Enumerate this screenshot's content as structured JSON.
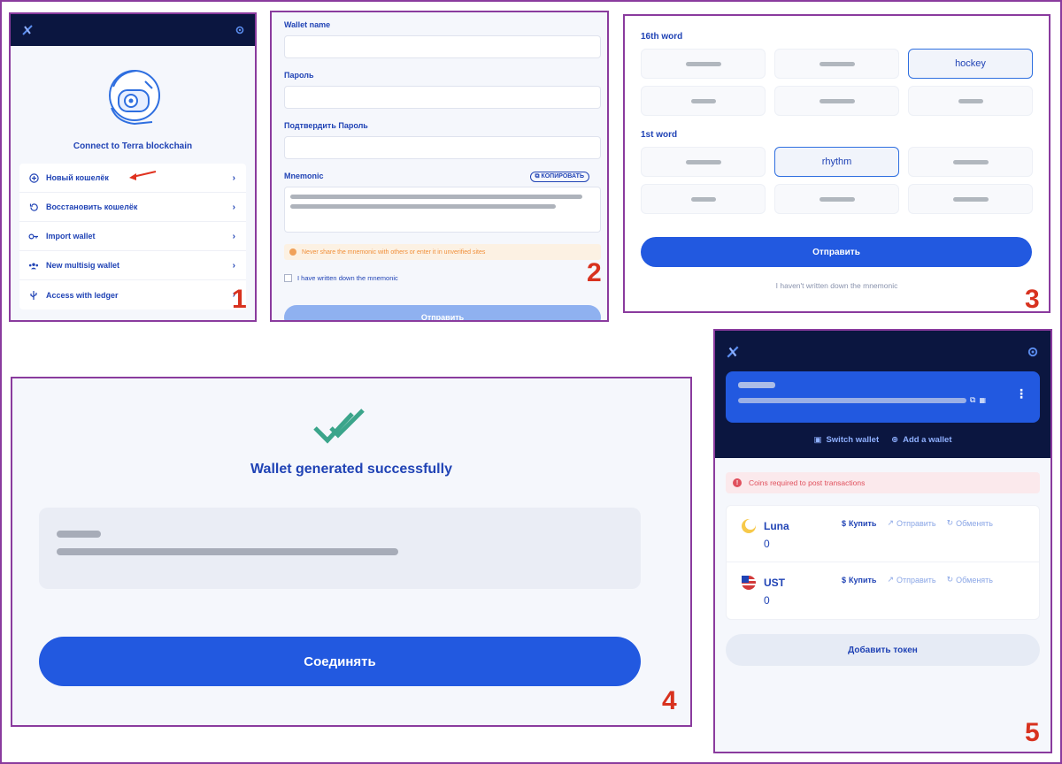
{
  "panel1": {
    "heading": "Connect to Terra blockchain",
    "menu": [
      {
        "label": "Новый кошелёк",
        "icon": "plus-circle-icon"
      },
      {
        "label": "Восстановить кошелёк",
        "icon": "restore-icon"
      },
      {
        "label": "Import wallet",
        "icon": "key-icon"
      },
      {
        "label": "New multisig wallet",
        "icon": "users-icon"
      },
      {
        "label": "Access with ledger",
        "icon": "usb-icon"
      }
    ],
    "step_number": "1"
  },
  "panel2": {
    "wallet_name_label": "Wallet name",
    "password_label": "Пароль",
    "confirm_password_label": "Подтвердить Пароль",
    "mnemonic_label": "Mnemonic",
    "copy_button": "КОПИРОВАТЬ",
    "warning": "Never share the mnemonic with others or enter it in unverified sites",
    "checkbox_label": "I have written down the mnemonic",
    "submit_button": "Отправить",
    "step_number": "2"
  },
  "panel3": {
    "word_label_1": "16th word",
    "word_label_2": "1st word",
    "selected_word_1": "hockey",
    "selected_word_2": "rhythm",
    "submit_button": "Отправить",
    "not_written_link": "I haven't written down the mnemonic",
    "step_number": "3"
  },
  "panel4": {
    "title": "Wallet generated successfully",
    "connect_button": "Соединять",
    "step_number": "4"
  },
  "panel5": {
    "switch_wallet": "Switch wallet",
    "add_wallet": "Add a wallet",
    "alert": "Coins required to post transactions",
    "coins": [
      {
        "name": "Luna",
        "balance": "0"
      },
      {
        "name": "UST",
        "balance": "0"
      }
    ],
    "actions": {
      "buy": "Купить",
      "send": "Отправить",
      "swap": "Обменять"
    },
    "add_token_button": "Добавить токен",
    "step_number": "5"
  }
}
